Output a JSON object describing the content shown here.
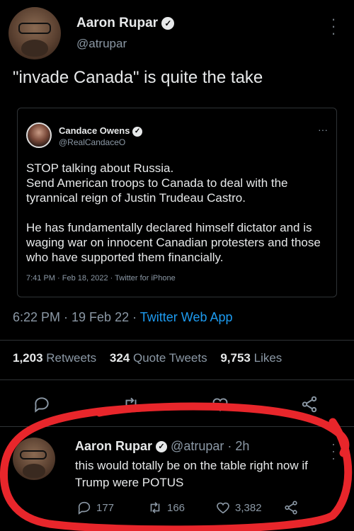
{
  "main_tweet": {
    "author_name": "Aaron Rupar",
    "author_handle": "@atrupar",
    "text": "\"invade Canada\" is quite the take",
    "timestamp": "6:22 PM · 19 Feb 22 · ",
    "source_app": "Twitter Web App",
    "stats": {
      "retweets_count": "1,203",
      "retweets_label": "Retweets",
      "quotes_count": "324",
      "quotes_label": "Quote Tweets",
      "likes_count": "9,753",
      "likes_label": "Likes"
    }
  },
  "quoted_tweet": {
    "author_name": "Candace Owens",
    "author_handle": "@RealCandaceO",
    "para1": "STOP talking about Russia.\nSend American troops to Canada to deal with the tyrannical reign of Justin Trudeau Castro.",
    "para2": "He has fundamentally declared himself dictator and is waging war on innocent Canadian protesters and those who have supported them financially.",
    "meta": "7:41 PM · Feb 18, 2022 · Twitter for iPhone",
    "more": "···"
  },
  "reply": {
    "author_name": "Aaron Rupar",
    "author_handle": "@atrupar · 2h",
    "text": "this would totally be on the table right now if Trump were POTUS",
    "replies": "177",
    "retweets": "166",
    "likes": "3,382"
  },
  "colors": {
    "accent": "#1d9bf0",
    "annotation": "#e8262b"
  }
}
